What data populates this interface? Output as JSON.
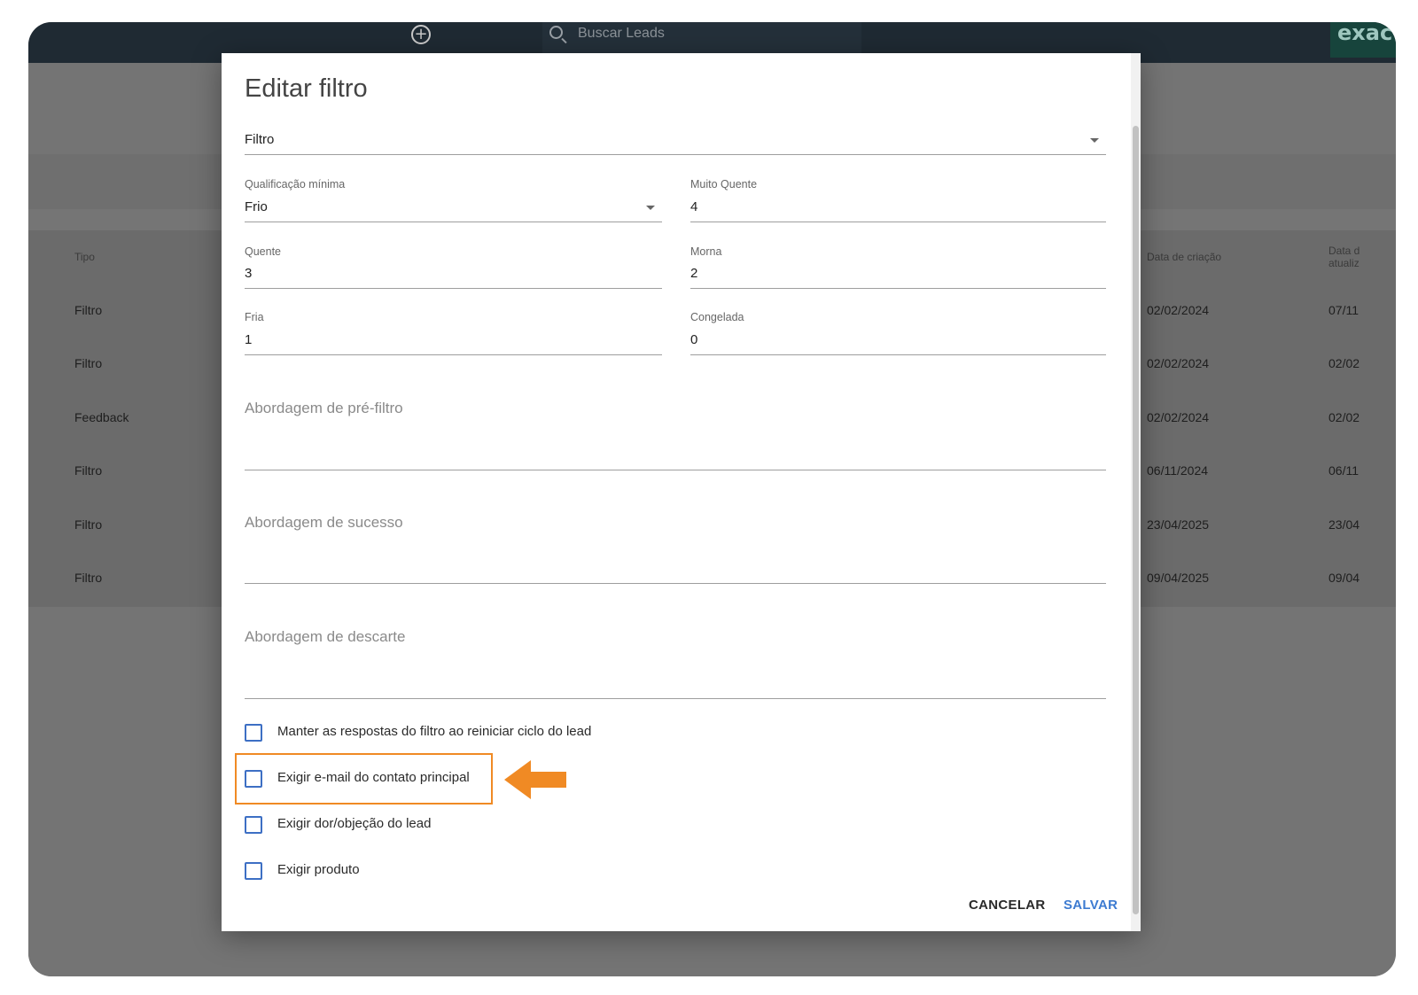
{
  "topbar": {
    "add_icon_glyph": "+",
    "search_placeholder": "Buscar Leads",
    "logo_text": "exact"
  },
  "background_table": {
    "headers": {
      "tipo": "Tipo",
      "data_criacao": "Data de criação",
      "data_atualizacao": "Data d\natualiz"
    },
    "rows": [
      {
        "tipo": "Filtro",
        "data_criacao": "02/02/2024",
        "data_atualizacao": "07/11"
      },
      {
        "tipo": "Filtro",
        "data_criacao": "02/02/2024",
        "data_atualizacao": "02/02"
      },
      {
        "tipo": "Feedback",
        "data_criacao": "02/02/2024",
        "data_atualizacao": "02/02"
      },
      {
        "tipo": "Filtro",
        "data_criacao": "06/11/2024",
        "data_atualizacao": "06/11"
      },
      {
        "tipo": "Filtro",
        "data_criacao": "23/04/2025",
        "data_atualizacao": "23/04"
      },
      {
        "tipo": "Filtro",
        "data_criacao": "09/04/2025",
        "data_atualizacao": "09/04"
      }
    ]
  },
  "dialog": {
    "title": "Editar filtro",
    "type_select": {
      "value": "Filtro"
    },
    "qualificacao_minima": {
      "label": "Qualificação mínima",
      "value": "Frio"
    },
    "muito_quente": {
      "label": "Muito Quente",
      "value": "4"
    },
    "quente": {
      "label": "Quente",
      "value": "3"
    },
    "morna": {
      "label": "Morna",
      "value": "2"
    },
    "fria": {
      "label": "Fria",
      "value": "1"
    },
    "congelada": {
      "label": "Congelada",
      "value": "0"
    },
    "abordagem_pre_filtro": {
      "label": "Abordagem de pré-filtro",
      "value": ""
    },
    "abordagem_sucesso": {
      "label": "Abordagem de sucesso",
      "value": ""
    },
    "abordagem_descarte": {
      "label": "Abordagem de descarte",
      "value": ""
    },
    "checkboxes": [
      {
        "label": "Manter as respostas do filtro ao reiniciar ciclo do lead",
        "checked": false
      },
      {
        "label": "Exigir e-mail do contato principal",
        "checked": false
      },
      {
        "label": "Exigir dor/objeção do lead",
        "checked": false
      },
      {
        "label": "Exigir produto",
        "checked": false
      }
    ],
    "cancel_label": "CANCELAR",
    "save_label": "SALVAR"
  },
  "colors": {
    "accent_blue": "#3d7bd1",
    "highlight_orange": "#f08a24",
    "topbar_dark": "#1f2a33",
    "overlay_gray": "#7a7a7a"
  }
}
